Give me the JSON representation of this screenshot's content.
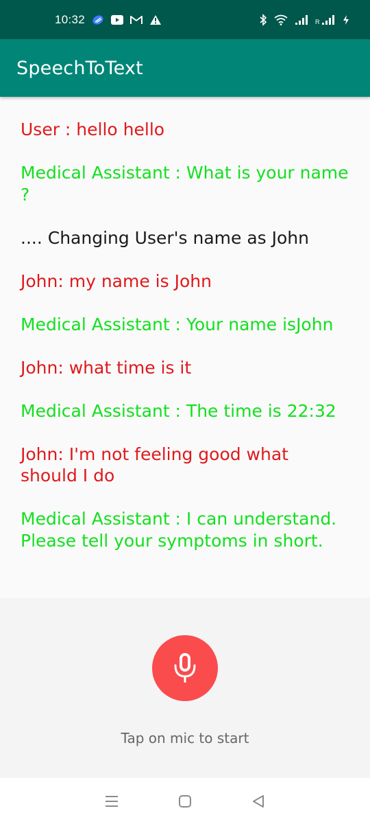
{
  "status_bar": {
    "time": "10:32",
    "left_icons": [
      "pinwheel-icon",
      "youtube-icon",
      "gmail-icon",
      "alert-icon"
    ],
    "right_icons": [
      "bluetooth-icon",
      "wifi-icon",
      "signal-icon",
      "roaming-signal-icon",
      "charging-icon"
    ],
    "roaming_label": "R"
  },
  "app_bar": {
    "title": "SpeechToText",
    "color": "#008577",
    "status_color": "#00574b"
  },
  "messages": [
    {
      "role": "user",
      "text": "User : hello hello"
    },
    {
      "role": "assistant",
      "text": "Medical Assistant : What is your name ?"
    },
    {
      "role": "system",
      "text": ".... Changing User's name as John"
    },
    {
      "role": "user",
      "text": "John: my name is John"
    },
    {
      "role": "assistant",
      "text": "Medical Assistant : Your name isJohn"
    },
    {
      "role": "user",
      "text": "John: what time is it"
    },
    {
      "role": "assistant",
      "text": "Medical Assistant : The time is 22:32"
    },
    {
      "role": "user",
      "text": "John: I'm not feeling good what should I do"
    },
    {
      "role": "assistant",
      "text": "Medical Assistant : I can understand. Please tell your symptoms in short."
    }
  ],
  "colors": {
    "user": "#e0191b",
    "assistant": "#13e01f",
    "system": "#1a1a1a",
    "mic": "#fa4b4d"
  },
  "mic": {
    "icon": "microphone-icon",
    "hint": "Tap on mic to start"
  },
  "nav_bar": {
    "icons": [
      "recents-icon",
      "home-icon",
      "back-icon"
    ]
  }
}
